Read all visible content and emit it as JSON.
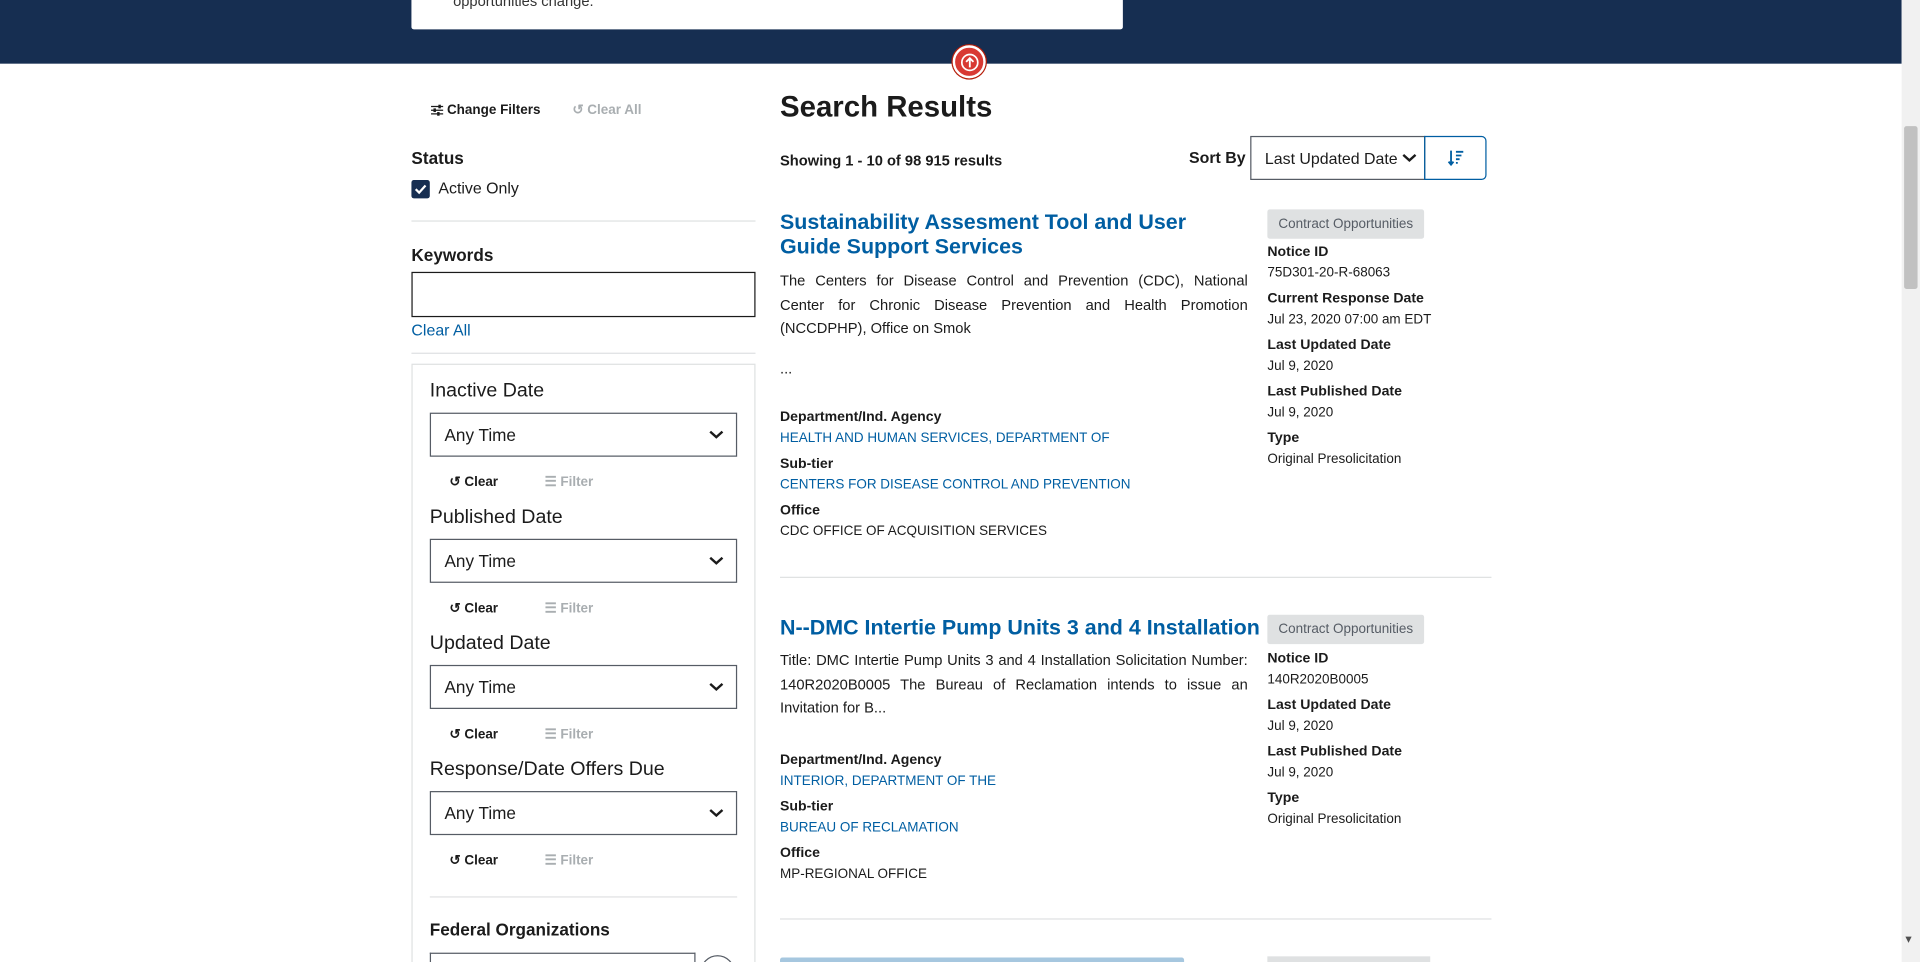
{
  "hero": {
    "card_text": "opportunities change."
  },
  "sidebar": {
    "change_filters": "Change Filters",
    "clear_all_top": "Clear All",
    "status_heading": "Status",
    "active_only": "Active Only",
    "active_only_checked": true,
    "keywords_heading": "Keywords",
    "keywords_value": "",
    "keywords_clear": "Clear All",
    "date_filters": [
      {
        "label": "Inactive Date",
        "value": "Any Time",
        "clear": "Clear",
        "filter": "Filter"
      },
      {
        "label": "Published Date",
        "value": "Any Time",
        "clear": "Clear",
        "filter": "Filter"
      },
      {
        "label": "Updated Date",
        "value": "Any Time",
        "clear": "Clear",
        "filter": "Filter"
      },
      {
        "label": "Response/Date Offers Due",
        "value": "Any Time",
        "clear": "Clear",
        "filter": "Filter"
      }
    ],
    "federal_orgs_heading": "Federal Organizations"
  },
  "main": {
    "title": "Search Results",
    "showing": "Showing 1 - 10 of 98 915 results",
    "sort_label": "Sort By",
    "sort_value": "Last Updated Date"
  },
  "results": [
    {
      "title": "Sustainability Assesment Tool and User Guide Support Services",
      "description": "The Centers for Disease Control and Prevention (CDC), National Center for Chronic Disease Prevention and Health Promotion (NCCDPHP), Office on Smok",
      "ellipsis": "...",
      "dept_label": "Department/Ind. Agency",
      "dept": "HEALTH AND HUMAN SERVICES, DEPARTMENT OF",
      "subtier_label": "Sub-tier",
      "subtier": "CENTERS FOR DISEASE CONTROL AND PREVENTION",
      "office_label": "Office",
      "office": "CDC OFFICE OF ACQUISITION SERVICES",
      "tag": "Contract Opportunities",
      "meta": [
        {
          "k": "Notice ID",
          "v": "75D301-20-R-68063"
        },
        {
          "k": "Current Response Date",
          "v": "Jul 23, 2020 07:00 am EDT"
        },
        {
          "k": "Last Updated Date",
          "v": "Jul 9, 2020"
        },
        {
          "k": "Last Published Date",
          "v": "Jul 9, 2020"
        },
        {
          "k": "Type",
          "v": "Original Presolicitation"
        }
      ]
    },
    {
      "title": "N--DMC Intertie Pump Units 3 and 4 Installation",
      "description": "Title: DMC Intertie Pump Units 3 and 4 Installation Solicitation Number: 140R2020B0005 The Bureau of Reclamation intends to issue an Invitation for B...",
      "dept_label": "Department/Ind. Agency",
      "dept": "INTERIOR, DEPARTMENT OF THE",
      "subtier_label": "Sub-tier",
      "subtier": "BUREAU OF RECLAMATION",
      "office_label": "Office",
      "office": "MP-REGIONAL OFFICE",
      "tag": "Contract Opportunities",
      "meta": [
        {
          "k": "Notice ID",
          "v": "140R2020B0005"
        },
        {
          "k": "Last Updated Date",
          "v": "Jul 9, 2020"
        },
        {
          "k": "Last Published Date",
          "v": "Jul 9, 2020"
        },
        {
          "k": "Type",
          "v": "Original Presolicitation"
        }
      ]
    }
  ],
  "colors": {
    "header_navy": "#162e51",
    "link_blue": "#005ea2",
    "back_to_top_red": "#d83933",
    "tag_gray": "#dfe1e2"
  }
}
